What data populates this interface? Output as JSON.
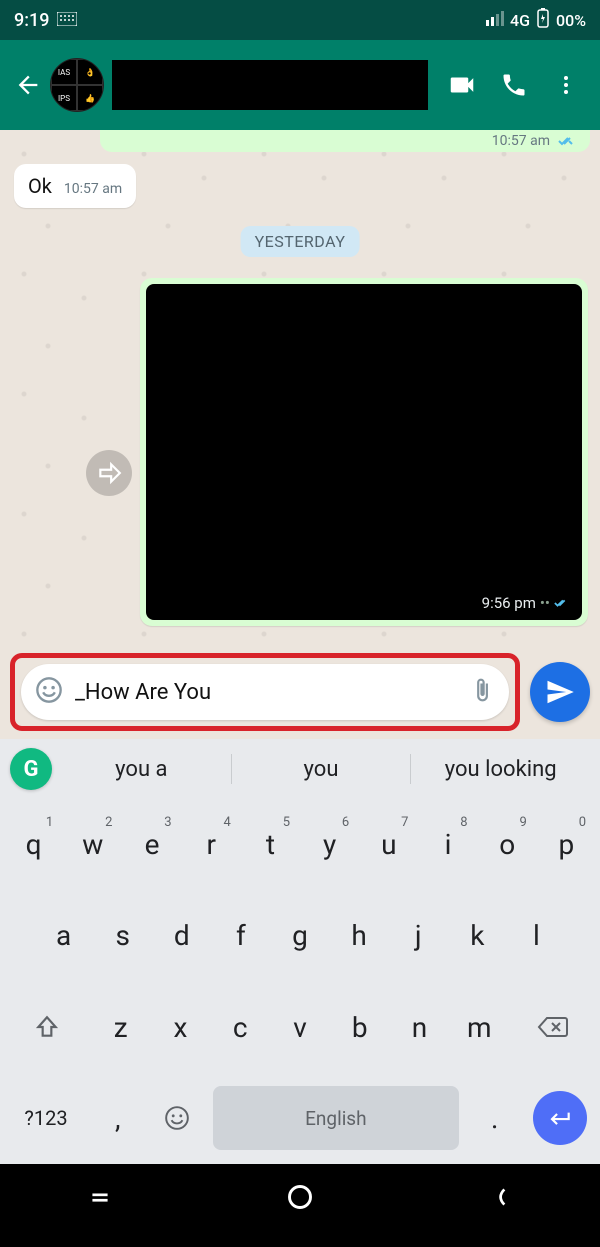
{
  "status": {
    "time": "9:19",
    "network": "4G",
    "battery": "00%"
  },
  "chat": {
    "partial_time": "10:57 am",
    "msg_in": {
      "text": "Ok",
      "time": "10:57 am"
    },
    "date_chip": "YESTERDAY",
    "image_msg": {
      "time": "9:56 pm"
    }
  },
  "compose": {
    "value": "_How Are You"
  },
  "suggestions": [
    "you a",
    "you",
    "you looking"
  ],
  "keyboard": {
    "row1": [
      "q",
      "w",
      "e",
      "r",
      "t",
      "y",
      "u",
      "i",
      "o",
      "p"
    ],
    "row1_nums": [
      "1",
      "2",
      "3",
      "4",
      "5",
      "6",
      "7",
      "8",
      "9",
      "0"
    ],
    "row2": [
      "a",
      "s",
      "d",
      "f",
      "g",
      "h",
      "j",
      "k",
      "l"
    ],
    "row3": [
      "z",
      "x",
      "c",
      "v",
      "b",
      "n",
      "m"
    ],
    "symbols_key": "?123",
    "space_label": "English"
  }
}
